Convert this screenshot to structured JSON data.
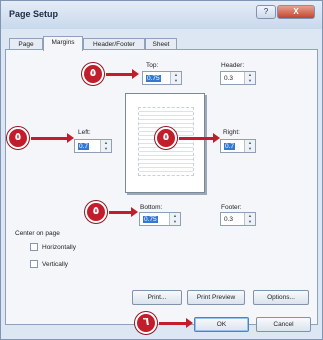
{
  "window": {
    "title": "Page Setup",
    "help": "?",
    "close": "X"
  },
  "tabs": [
    "Page",
    "Margins",
    "Header/Footer",
    "Sheet"
  ],
  "margins": {
    "top": {
      "label": "Top:",
      "value": "0.75"
    },
    "header": {
      "label": "Header:",
      "value": "0.3"
    },
    "left": {
      "label": "Left:",
      "value": "0.7"
    },
    "right": {
      "label": "Right:",
      "value": "0.7"
    },
    "bottom": {
      "label": "Bottom:",
      "value": "0.75"
    },
    "footer": {
      "label": "Footer:",
      "value": "0.3"
    }
  },
  "center": {
    "heading": "Center on page",
    "horizontally": "Horizontally",
    "vertically": "Vertically"
  },
  "buttons": {
    "print": "Print...",
    "preview": "Print Preview",
    "options": "Options...",
    "ok": "OK",
    "cancel": "Cancel"
  },
  "callouts": {
    "step5": "٥",
    "step6": "٦"
  },
  "colors": {
    "callout": "#c31d2b",
    "accent": "#3478d4"
  }
}
